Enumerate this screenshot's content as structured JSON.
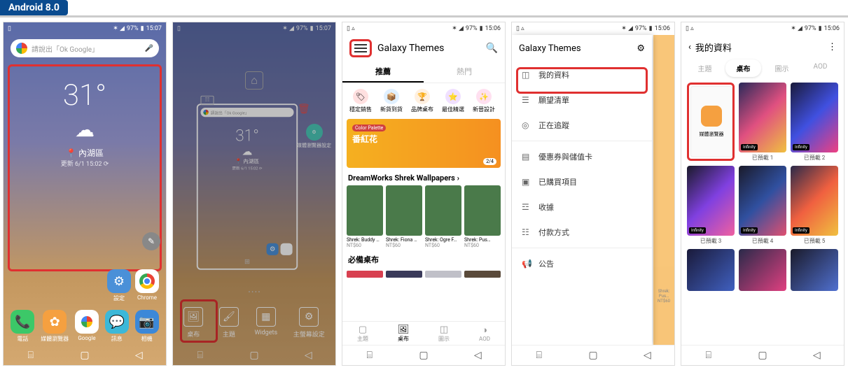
{
  "page_title": "Android 8.0",
  "status": {
    "battery": "97%",
    "time_a": "15:07",
    "time_b": "15:06"
  },
  "p1": {
    "search_placeholder": "請說出「Ok Google」",
    "temp": "31°",
    "location": "內湖區",
    "update": "更新 6/1 15:02 ⟳",
    "apps_row": [
      {
        "name": "設定"
      },
      {
        "name": "Chrome"
      }
    ],
    "dock": [
      "電話",
      "媒體瀏覽器",
      "Google",
      "訊息",
      "相機"
    ]
  },
  "p2": {
    "search_placeholder": "請說出「Ok Google」",
    "temp": "31°",
    "location": "內湖區",
    "update": "更新 6/1 15:02 ⟳",
    "side_label": "媒體瀏覽器設定",
    "apps": [
      "設定",
      "Chrome"
    ],
    "tools": [
      "桌布",
      "主題",
      "Widgets",
      "主螢幕設定"
    ]
  },
  "p3": {
    "title": "Galaxy Themes",
    "tabs": [
      "推薦",
      "熱門"
    ],
    "chips": [
      "穩定銷售",
      "新貨到貨",
      "品牌桌布",
      "最佳精選",
      "新晉設計"
    ],
    "banner_tag": "Color Palette",
    "banner_title": "番紅花",
    "banner_count": "2/4",
    "section1": "DreamWorks Shrek Wallpapers",
    "cards": [
      {
        "name": "Shrek: Buddy …",
        "price": "NT$60"
      },
      {
        "name": "Shrek: Fiona …",
        "price": "NT$60"
      },
      {
        "name": "Shrek: Ogre F…",
        "price": "NT$60"
      },
      {
        "name": "Shrek: Pus…",
        "price": "NT$60"
      }
    ],
    "section2": "必備桌布",
    "bottom_tabs": [
      "主題",
      "桌布",
      "圖示",
      "AOD"
    ]
  },
  "p4": {
    "title": "Galaxy Themes",
    "items": [
      "我的資料",
      "願望清單",
      "正在追蹤",
      "優惠券與儲值卡",
      "已購買項目",
      "收據",
      "付款方式",
      "公告"
    ],
    "peek_name": "Shrek: Pus…",
    "peek_price": "NT$60"
  },
  "p5": {
    "title": "我的資料",
    "tabs": [
      "主題",
      "桌布",
      "圖示",
      "AOD"
    ],
    "default_label": "媒體瀏覽器",
    "labels": [
      "",
      "已預載 1",
      "已預載 2",
      "已預載 3",
      "已預載 4",
      "已預載 5"
    ],
    "infinity": "Infinity"
  }
}
